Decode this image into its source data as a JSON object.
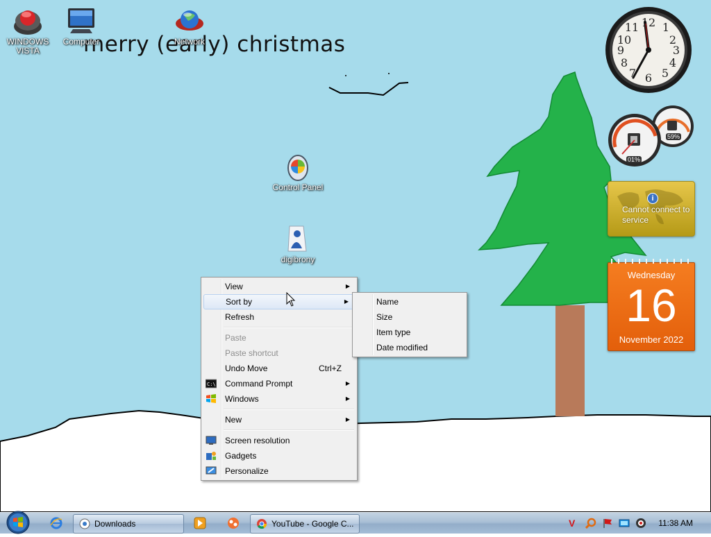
{
  "desktop": {
    "greeting": "merry (early) christmas",
    "icons": [
      {
        "label": "WINDOWS VISTA",
        "icon": "vista-orb-icon"
      },
      {
        "label": "Computer",
        "icon": "computer-icon"
      },
      {
        "label": "Network",
        "icon": "network-icon"
      },
      {
        "label": "Control Panel",
        "icon": "control-panel-icon"
      },
      {
        "label": "digibrony",
        "icon": "user-folder-icon"
      }
    ]
  },
  "gadgets": {
    "clock": {
      "time": "11:38"
    },
    "cpu_meter": {
      "cpu": "01%",
      "memory": "59%"
    },
    "weather": {
      "message": "Cannot connect to service"
    },
    "calendar": {
      "weekday": "Wednesday",
      "day": "16",
      "month_year": "November 2022"
    }
  },
  "context_menu": {
    "items": [
      {
        "label": "View",
        "submenu": true
      },
      {
        "label": "Sort by",
        "submenu": true
      },
      {
        "label": "Refresh"
      },
      {
        "label": "Paste",
        "disabled": true
      },
      {
        "label": "Paste shortcut",
        "disabled": true
      },
      {
        "label": "Undo Move",
        "shortcut": "Ctrl+Z"
      },
      {
        "label": "Command Prompt",
        "submenu": true,
        "icon": "command-prompt-icon"
      },
      {
        "label": "Windows",
        "submenu": true,
        "icon": "windows-flag-icon"
      },
      {
        "label": "New",
        "submenu": true
      },
      {
        "label": "Screen resolution",
        "icon": "screen-resolution-icon"
      },
      {
        "label": "Gadgets",
        "icon": "gadgets-icon"
      },
      {
        "label": "Personalize",
        "icon": "personalize-icon"
      }
    ]
  },
  "sort_submenu": {
    "items": [
      "Name",
      "Size",
      "Item type",
      "Date modified"
    ]
  },
  "taskbar": {
    "buttons": [
      {
        "label": "Downloads",
        "icon": "folder-icon"
      },
      {
        "label": "YouTube - Google C...",
        "icon": "chrome-icon"
      }
    ],
    "clock": "11:38 AM"
  }
}
